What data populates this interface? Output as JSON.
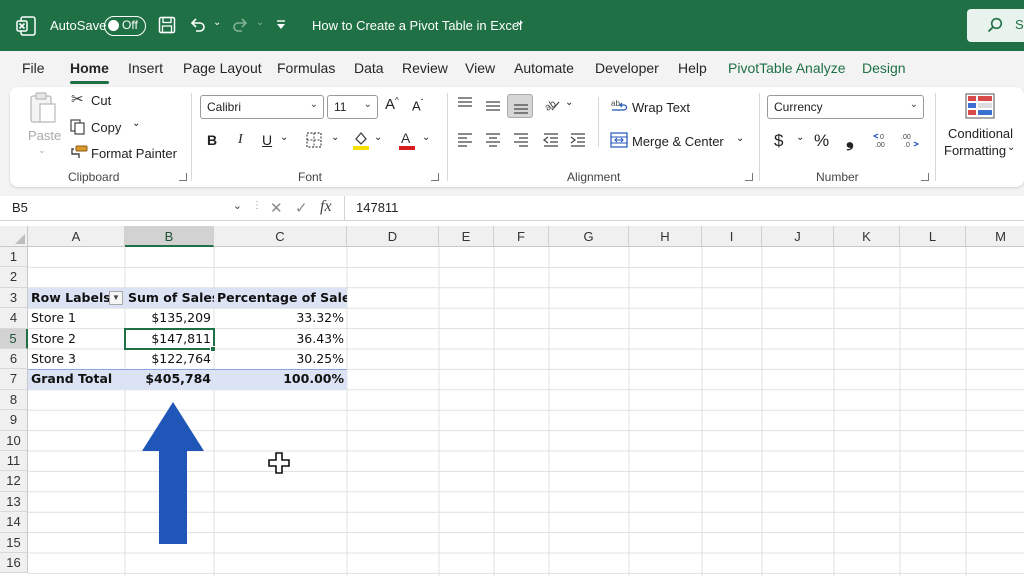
{
  "titlebar": {
    "autosave_label": "AutoSave",
    "autosave_state": "Off",
    "doc_title": "How to Create a Pivot Table in Excel",
    "title_chevron": "⌄",
    "search_partial": "S"
  },
  "tabs": [
    "File",
    "Home",
    "Insert",
    "Page Layout",
    "Formulas",
    "Data",
    "Review",
    "View",
    "Automate",
    "Developer",
    "Help",
    "PivotTable Analyze",
    "Design"
  ],
  "ribbon": {
    "clipboard": {
      "paste": "Paste",
      "cut": "Cut",
      "copy": "Copy",
      "format_painter": "Format Painter",
      "group": "Clipboard"
    },
    "font": {
      "name": "Calibri",
      "size": "11",
      "bold": "B",
      "italic": "I",
      "underline": "U",
      "group": "Font"
    },
    "alignment": {
      "wrap_text": "Wrap Text",
      "merge_center": "Merge & Center",
      "group": "Alignment"
    },
    "number": {
      "format": "Currency",
      "dollar": "$",
      "percent": "%",
      "comma": "❟",
      "group": "Number"
    },
    "styles": {
      "conditional": "Conditional",
      "formatting": "Formatting"
    }
  },
  "formula_bar": {
    "name_box": "B5",
    "formula": "147811",
    "fx": "fx"
  },
  "columns": [
    "A",
    "B",
    "C",
    "D",
    "E",
    "F",
    "G",
    "H",
    "I",
    "J",
    "K",
    "L",
    "M"
  ],
  "rows": [
    "1",
    "2",
    "3",
    "4",
    "5",
    "6",
    "7",
    "8",
    "9",
    "10",
    "11",
    "12",
    "13",
    "14",
    "15",
    "16"
  ],
  "pivot": {
    "headers": [
      "Row Labels",
      "Sum of Sales",
      "Percentage of Sales"
    ],
    "rows": [
      [
        "Store 1",
        "$135,209",
        "33.32%"
      ],
      [
        "Store 2",
        "$147,811",
        "36.43%"
      ],
      [
        "Store 3",
        "$122,764",
        "30.25%"
      ]
    ],
    "total": [
      "Grand Total",
      "$405,784",
      "100.00%"
    ]
  },
  "colors": {
    "excel_green": "#1f7145",
    "pivot_band": "#dce3f5",
    "arrow_blue": "#1f56b8"
  }
}
